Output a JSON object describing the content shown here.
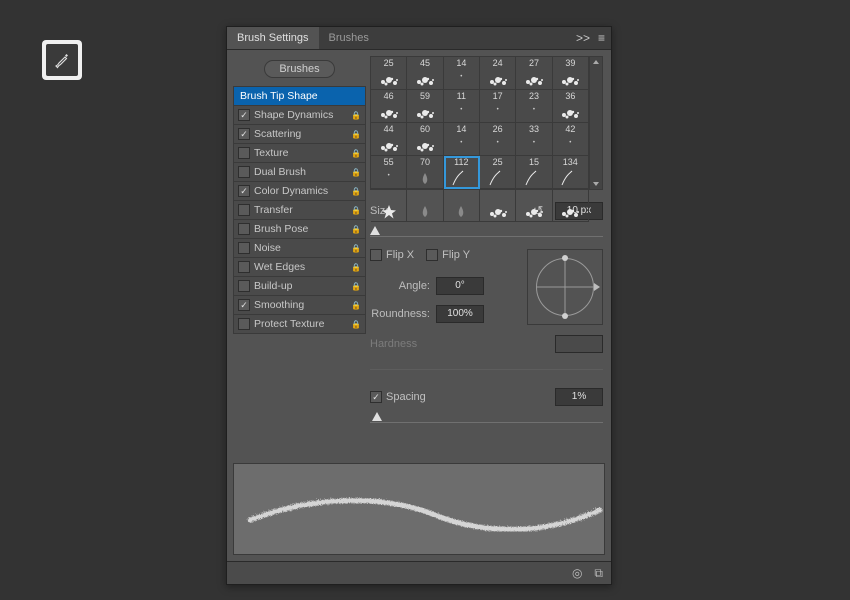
{
  "tabs": {
    "main": "Brush Settings",
    "alt": "Brushes",
    "collapse": ">>",
    "menu": "≡"
  },
  "buttons": {
    "presets": "Brushes"
  },
  "settings": [
    {
      "label": "Brush Tip Shape",
      "hasCheckbox": false,
      "checked": false,
      "locked": false,
      "selected": true
    },
    {
      "label": "Shape Dynamics",
      "hasCheckbox": true,
      "checked": true,
      "locked": true
    },
    {
      "label": "Scattering",
      "hasCheckbox": true,
      "checked": true,
      "locked": true
    },
    {
      "label": "Texture",
      "hasCheckbox": true,
      "checked": false,
      "locked": true
    },
    {
      "label": "Dual Brush",
      "hasCheckbox": true,
      "checked": false,
      "locked": true
    },
    {
      "label": "Color Dynamics",
      "hasCheckbox": true,
      "checked": true,
      "locked": true
    },
    {
      "label": "Transfer",
      "hasCheckbox": true,
      "checked": false,
      "locked": true
    },
    {
      "label": "Brush Pose",
      "hasCheckbox": true,
      "checked": false,
      "locked": true
    },
    {
      "label": "Noise",
      "hasCheckbox": true,
      "checked": false,
      "locked": true
    },
    {
      "label": "Wet Edges",
      "hasCheckbox": true,
      "checked": false,
      "locked": true
    },
    {
      "label": "Build-up",
      "hasCheckbox": true,
      "checked": false,
      "locked": true
    },
    {
      "label": "Smoothing",
      "hasCheckbox": true,
      "checked": true,
      "locked": true
    },
    {
      "label": "Protect Texture",
      "hasCheckbox": true,
      "checked": false,
      "locked": true
    }
  ],
  "brushes": [
    {
      "n": "25",
      "t": "splat"
    },
    {
      "n": "45",
      "t": "splat"
    },
    {
      "n": "14",
      "t": "dot"
    },
    {
      "n": "24",
      "t": "splat"
    },
    {
      "n": "27",
      "t": "splat"
    },
    {
      "n": "39",
      "t": "splat"
    },
    {
      "n": "46",
      "t": "splat"
    },
    {
      "n": "59",
      "t": "splat"
    },
    {
      "n": "11",
      "t": "dot"
    },
    {
      "n": "17",
      "t": "dot"
    },
    {
      "n": "23",
      "t": "dot"
    },
    {
      "n": "36",
      "t": "splat"
    },
    {
      "n": "44",
      "t": "splat"
    },
    {
      "n": "60",
      "t": "splat"
    },
    {
      "n": "14",
      "t": "dot"
    },
    {
      "n": "26",
      "t": "dot"
    },
    {
      "n": "33",
      "t": "dot"
    },
    {
      "n": "42",
      "t": "dot"
    },
    {
      "n": "55",
      "t": "dot"
    },
    {
      "n": "70",
      "t": "drop"
    },
    {
      "n": "112",
      "t": "curve",
      "sel": true
    },
    {
      "n": "25",
      "t": "curve"
    },
    {
      "n": "15",
      "t": "curve"
    },
    {
      "n": "134",
      "t": "curve"
    },
    {
      "n": "",
      "t": "star"
    },
    {
      "n": "",
      "t": "drop"
    },
    {
      "n": "",
      "t": "drop"
    },
    {
      "n": "",
      "t": "splat"
    },
    {
      "n": "",
      "t": "splat"
    },
    {
      "n": "",
      "t": "splat"
    }
  ],
  "size": {
    "label": "Size",
    "value": "10 px",
    "reset": "↺",
    "thumb": 2
  },
  "flip": {
    "x": "Flip X",
    "y": "Flip Y",
    "x_on": false,
    "y_on": false
  },
  "angle": {
    "label": "Angle:",
    "value": "0°"
  },
  "roundness": {
    "label": "Roundness:",
    "value": "100%"
  },
  "hardness": {
    "label": "Hardness",
    "value": ""
  },
  "spacing": {
    "label": "Spacing",
    "checked": true,
    "value": "1%",
    "thumb": 3
  },
  "footer": {
    "visibility": "◎",
    "new": "⧉"
  }
}
